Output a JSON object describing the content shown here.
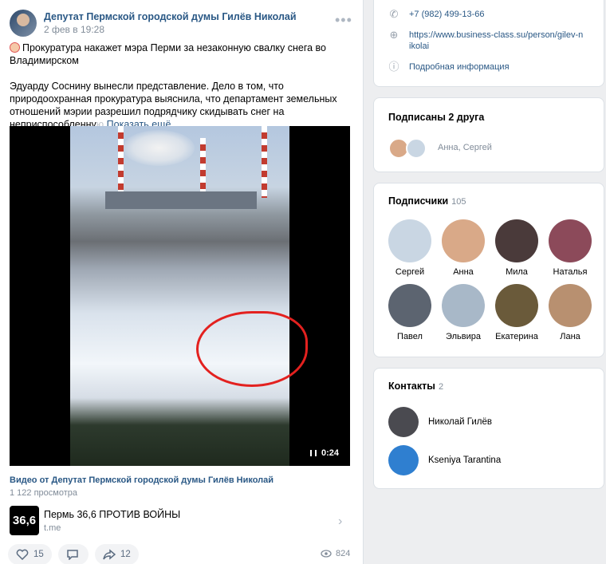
{
  "post": {
    "author": "Депутат Пермской городской думы Гилёв Николай",
    "date": "2 фев в 19:28",
    "more": "•••",
    "text_line1": "Прокуратура накажет мэра Перми за незаконную свалку снега во Владимирском",
    "text_line2_main": "Эдуарду Соснину вынесли представление. Дело в том, что природоохранная прокуратура выяснила, что департамент земельных отношений мэрии разрешил подрядчику скидывать снег на неприспособленну",
    "text_line2_fade": "ю",
    "show_more": "Показать ещё",
    "video": {
      "duration": "0:24",
      "title": "Видео от Депутат Пермской городской думы Гилёв Николай",
      "views": "1 122 просмотра"
    },
    "link": {
      "logo": "36,6",
      "title": "Пермь 36,6 ПРОТИВ ВОЙНЫ",
      "url": "t.me"
    },
    "likes": "15",
    "shares": "12",
    "views": "824"
  },
  "sidebar": {
    "phone": "+7 (982) 499-13-66",
    "website": "https://www.business-class.su/person/gilev-nikolai",
    "more_info": "Подробная информация",
    "friends": {
      "title": "Подписаны 2 друга",
      "names": "Анна, Сергей"
    },
    "subscribers": {
      "title": "Подписчики",
      "count": "105",
      "people": [
        {
          "name": "Сергей",
          "color": "#c9d6e3"
        },
        {
          "name": "Анна",
          "color": "#d9a988"
        },
        {
          "name": "Мила",
          "color": "#4a3a3a"
        },
        {
          "name": "Наталья",
          "color": "#8c4a5a"
        },
        {
          "name": "Павел",
          "color": "#5c6470"
        },
        {
          "name": "Эльвира",
          "color": "#a8b8c8"
        },
        {
          "name": "Екатерина",
          "color": "#6a5a3a"
        },
        {
          "name": "Лана",
          "color": "#b89070"
        }
      ]
    },
    "contacts": {
      "title": "Контакты",
      "count": "2",
      "items": [
        {
          "name": "Николай Гилёв",
          "color": "#4a4a50"
        },
        {
          "name": "Kseniya Tarantina",
          "color": "#2f7fd0"
        }
      ]
    }
  }
}
